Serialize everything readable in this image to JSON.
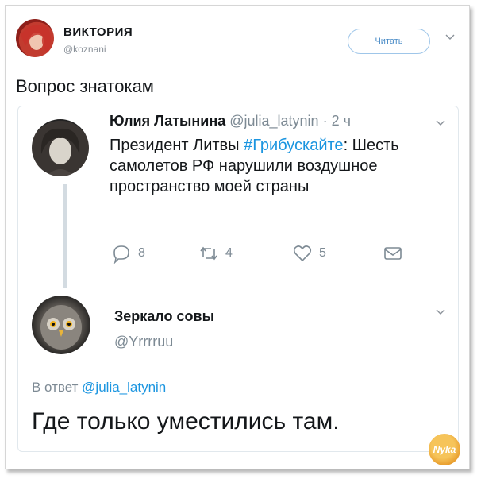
{
  "main_tweet": {
    "author_name": "ВИКТОРИЯ",
    "author_handle": "@koznani",
    "read_button_label": "Читать",
    "text": "Вопрос знатокам"
  },
  "quoted_thread": {
    "first": {
      "author_name": "Юлия Латынина",
      "author_handle": "@julia_latynin",
      "time_sep": " · ",
      "time": "2 ч",
      "text_before": "Президент Литвы ",
      "hashtag": "#Грибускайте",
      "text_after": ": Шесть самолетов РФ нарушили воздушное пространство моей страны",
      "replies": "8",
      "retweets": "4",
      "likes": "5"
    },
    "second": {
      "author_name": "Зеркало совы",
      "author_handle": "@Yrrrruu",
      "reply_prefix": "В ответ ",
      "reply_mention": "@julia_latynin",
      "text": "Где только уместились там."
    }
  },
  "watermark": {
    "text": "Nyka"
  },
  "colors": {
    "link": "#1b95e0",
    "muted": "#7d8a94",
    "button_border": "#9fc6e9",
    "thread_line": "#d3dbe1"
  },
  "icons": [
    "chevron-down-icon",
    "reply-icon",
    "retweet-icon",
    "heart-icon",
    "message-icon"
  ]
}
